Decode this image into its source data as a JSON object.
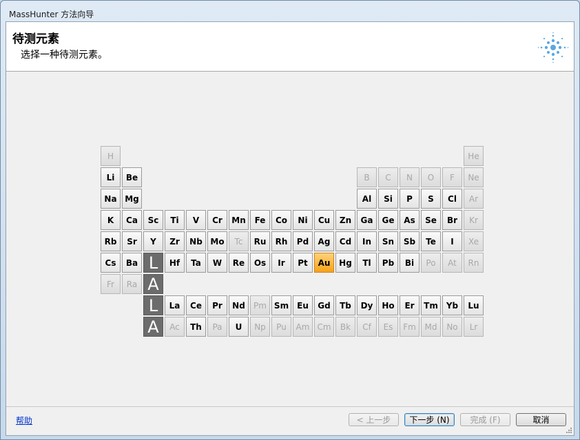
{
  "window": {
    "title": "MassHunter 方法向导"
  },
  "header": {
    "title": "待测元素",
    "subtitle": "选择一种待测元素。",
    "logo_icon": "agilent-spark-icon"
  },
  "colors": {
    "selected": "#f6a21a",
    "disabled_text": "#a8a8a8",
    "la_block": "#6c6c6c"
  },
  "periodic_table": {
    "selected": "Au",
    "rows": [
      [
        [
          "H",
          0,
          0
        ]
      ],
      [
        [
          "Li",
          0,
          1
        ],
        [
          "Be",
          1,
          1
        ],
        [
          "B",
          12,
          0
        ],
        [
          "C",
          13,
          0
        ],
        [
          "N",
          14,
          0
        ],
        [
          "O",
          15,
          0
        ],
        [
          "F",
          16,
          0
        ]
      ],
      [
        [
          "Na",
          0,
          1
        ],
        [
          "Mg",
          1,
          1
        ],
        [
          "Al",
          12,
          1
        ],
        [
          "Si",
          13,
          1
        ],
        [
          "P",
          14,
          1
        ],
        [
          "S",
          15,
          1
        ],
        [
          "Cl",
          16,
          1
        ]
      ],
      [
        [
          "K",
          0,
          1
        ],
        [
          "Ca",
          1,
          1
        ],
        [
          "Sc",
          2,
          1
        ],
        [
          "Ti",
          3,
          1
        ],
        [
          "V",
          4,
          1
        ],
        [
          "Cr",
          5,
          1
        ],
        [
          "Mn",
          6,
          1
        ],
        [
          "Fe",
          7,
          1
        ],
        [
          "Co",
          8,
          1
        ],
        [
          "Ni",
          9,
          1
        ],
        [
          "Cu",
          10,
          1
        ],
        [
          "Zn",
          11,
          1
        ],
        [
          "Ga",
          12,
          1
        ],
        [
          "Ge",
          13,
          1
        ],
        [
          "As",
          14,
          1
        ],
        [
          "Se",
          15,
          1
        ],
        [
          "Br",
          16,
          1
        ]
      ],
      [
        [
          "Rb",
          0,
          1
        ],
        [
          "Sr",
          1,
          1
        ],
        [
          "Y",
          2,
          1
        ],
        [
          "Zr",
          3,
          1
        ],
        [
          "Nb",
          4,
          1
        ],
        [
          "Mo",
          5,
          1
        ],
        [
          "Tc",
          6,
          0
        ],
        [
          "Ru",
          7,
          1
        ],
        [
          "Rh",
          8,
          1
        ],
        [
          "Pd",
          9,
          1
        ],
        [
          "Ag",
          10,
          1
        ],
        [
          "Cd",
          11,
          1
        ],
        [
          "In",
          12,
          1
        ],
        [
          "Sn",
          13,
          1
        ],
        [
          "Sb",
          14,
          1
        ],
        [
          "Te",
          15,
          1
        ],
        [
          "I",
          16,
          1
        ]
      ],
      [
        [
          "Cs",
          0,
          1
        ],
        [
          "Ba",
          1,
          1
        ],
        [
          "Hf",
          3,
          1
        ],
        [
          "Ta",
          4,
          1
        ],
        [
          "W",
          5,
          1
        ],
        [
          "Re",
          6,
          1
        ],
        [
          "Os",
          7,
          1
        ],
        [
          "Ir",
          8,
          1
        ],
        [
          "Pt",
          9,
          1
        ],
        [
          "Au",
          10,
          1
        ],
        [
          "Hg",
          11,
          1
        ],
        [
          "Tl",
          12,
          1
        ],
        [
          "Pb",
          13,
          1
        ],
        [
          "Bi",
          14,
          1
        ],
        [
          "Po",
          15,
          0
        ],
        [
          "At",
          16,
          0
        ]
      ],
      [
        [
          "Fr",
          0,
          0
        ],
        [
          "Ra",
          1,
          0
        ]
      ]
    ],
    "noble_gases": [
      [
        "He",
        0
      ],
      [
        "Ne",
        0
      ],
      [
        "Ar",
        0
      ],
      [
        "Kr",
        0
      ],
      [
        "Xe",
        0
      ],
      [
        "Rn",
        0
      ]
    ],
    "lanthanides": [
      [
        "La",
        1
      ],
      [
        "Ce",
        1
      ],
      [
        "Pr",
        1
      ],
      [
        "Nd",
        1
      ],
      [
        "Pm",
        0
      ],
      [
        "Sm",
        1
      ],
      [
        "Eu",
        1
      ],
      [
        "Gd",
        1
      ],
      [
        "Tb",
        1
      ],
      [
        "Dy",
        1
      ],
      [
        "Ho",
        1
      ],
      [
        "Er",
        1
      ],
      [
        "Tm",
        1
      ],
      [
        "Yb",
        1
      ],
      [
        "Lu",
        1
      ]
    ],
    "actinides": [
      [
        "Ac",
        0
      ],
      [
        "Th",
        1
      ],
      [
        "Pa",
        0
      ],
      [
        "U",
        1
      ],
      [
        "Np",
        0
      ],
      [
        "Pu",
        0
      ],
      [
        "Am",
        0
      ],
      [
        "Cm",
        0
      ],
      [
        "Bk",
        0
      ],
      [
        "Cf",
        0
      ],
      [
        "Es",
        0
      ],
      [
        "Fm",
        0
      ],
      [
        "Md",
        0
      ],
      [
        "No",
        0
      ],
      [
        "Lr",
        0
      ]
    ],
    "la_labels": [
      "L",
      "A",
      "L",
      "A"
    ]
  },
  "footer": {
    "help": "帮助",
    "back": "< 上一步",
    "next": "下一步 (N)",
    "finish": "完成 (F)",
    "cancel": "取消"
  }
}
